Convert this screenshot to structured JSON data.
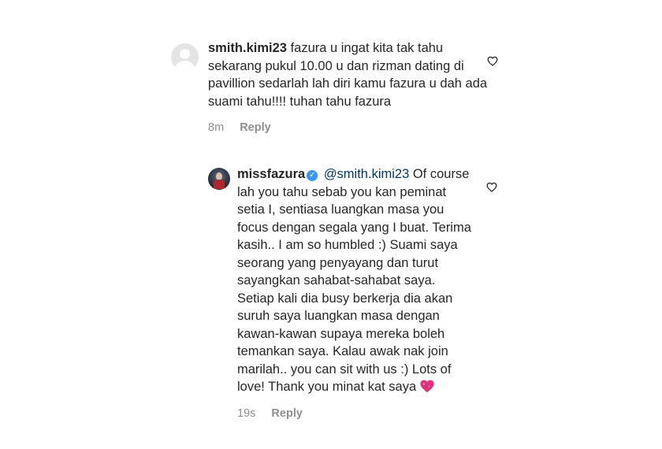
{
  "comments": [
    {
      "username": "smith.kimi23",
      "body": "fazura u ingat kita tak tahu sekarang pukul 10.00 u dan rizman dating di pavillion sedarlah lah diri kamu fazura u dah ada suami tahu!!!! tuhan tahu fazura",
      "time": "8m",
      "reply_label": "Reply",
      "avatar": "default-avatar-icon",
      "like_icon": "heart-outline-icon"
    },
    {
      "username": "missfazura",
      "verified_icon": "verified-badge-icon",
      "mention": "@smith.kimi23",
      "body": "Of course lah you tahu sebab you kan peminat setia I, sentiasa luangkan masa you focus dengan segala yang I buat. Terima kasih.. I am so humbled :) Suami saya seorang yang penyayang dan turut sayangkan sahabat-sahabat saya. Setiap kali dia busy berkerja dia akan suruh saya luangkan masa dengan kawan-kawan supaya mereka boleh temankan saya. Kalau awak nak join marilah.. you can sit with us :) Lots of love! Thank you minat kat saya",
      "emoji": "sparkling-heart-emoji",
      "time": "19s",
      "reply_label": "Reply",
      "like_icon": "heart-outline-icon"
    }
  ],
  "colors": {
    "text": "#262626",
    "meta": "#8e8e8e",
    "verified": "#3897f0",
    "mention": "#00376b",
    "emoji_heart": "#e0307a"
  }
}
